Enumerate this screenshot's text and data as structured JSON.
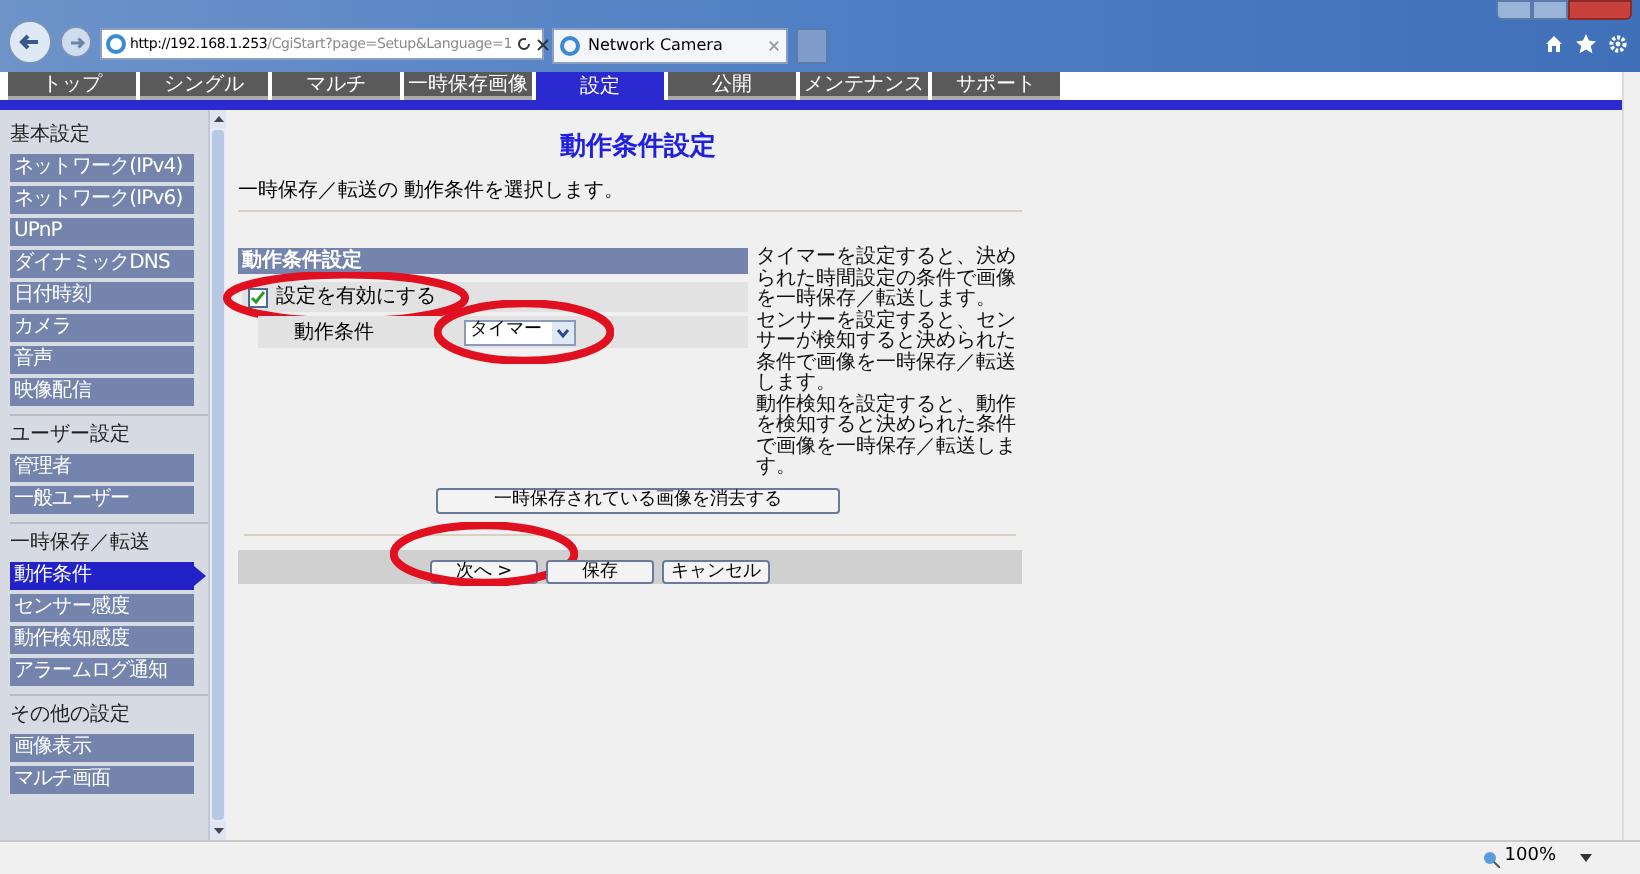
{
  "browser": {
    "url_host": "http://192.168.1.253",
    "url_path": "/CgiStart?page=Setup&Language=1",
    "tab_title": "Network Camera",
    "zoom": "100%"
  },
  "nav_tabs": [
    {
      "label": "トップ",
      "selected": false
    },
    {
      "label": "シングル",
      "selected": false
    },
    {
      "label": "マルチ",
      "selected": false
    },
    {
      "label": "一時保存画像",
      "selected": false
    },
    {
      "label": "設定",
      "selected": true
    },
    {
      "label": "公開",
      "selected": false
    },
    {
      "label": "メンテナンス",
      "selected": false
    },
    {
      "label": "サポート",
      "selected": false
    }
  ],
  "sidebar": {
    "sections": [
      {
        "title": "基本設定",
        "items": [
          {
            "label": "ネットワーク(IPv4)",
            "selected": false
          },
          {
            "label": "ネットワーク(IPv6)",
            "selected": false
          },
          {
            "label": "UPnP",
            "selected": false
          },
          {
            "label": "ダイナミックDNS",
            "selected": false
          },
          {
            "label": "日付時刻",
            "selected": false
          },
          {
            "label": "カメラ",
            "selected": false
          },
          {
            "label": "音声",
            "selected": false
          },
          {
            "label": "映像配信",
            "selected": false
          }
        ]
      },
      {
        "title": "ユーザー設定",
        "items": [
          {
            "label": "管理者",
            "selected": false
          },
          {
            "label": "一般ユーザー",
            "selected": false
          }
        ]
      },
      {
        "title": "一時保存／転送",
        "items": [
          {
            "label": "動作条件",
            "selected": true
          },
          {
            "label": "センサー感度",
            "selected": false
          },
          {
            "label": "動作検知感度",
            "selected": false
          },
          {
            "label": "アラームログ通知",
            "selected": false
          }
        ]
      },
      {
        "title": "その他の設定",
        "items": [
          {
            "label": "画像表示",
            "selected": false
          },
          {
            "label": "マルチ画面",
            "selected": false
          }
        ]
      }
    ]
  },
  "page": {
    "title": "動作条件設定",
    "description": "一時保存／転送の 動作条件を選択します。",
    "panel": {
      "header": "動作条件設定",
      "enable": {
        "label": "設定を有効にする",
        "checked": true,
        "highlighted": true
      },
      "condition": {
        "label": "動作条件",
        "value": "タイマー",
        "highlighted": true
      }
    },
    "help": [
      "タイマーを設定すると、決められた時間設定の条件で画像を一時保存／転送します。",
      "センサーを設定すると、センサーが検知すると決められた条件で画像を一時保存／転送します。",
      "動作検知を設定すると、動作を検知すると決められた条件で画像を一時保存／転送します。"
    ],
    "delete_button": "一時保存されている画像を消去する",
    "buttons": [
      {
        "label": "次へ >",
        "highlighted": true
      },
      {
        "label": "保存",
        "highlighted": false
      },
      {
        "label": "キャンセル",
        "highlighted": false
      }
    ]
  }
}
